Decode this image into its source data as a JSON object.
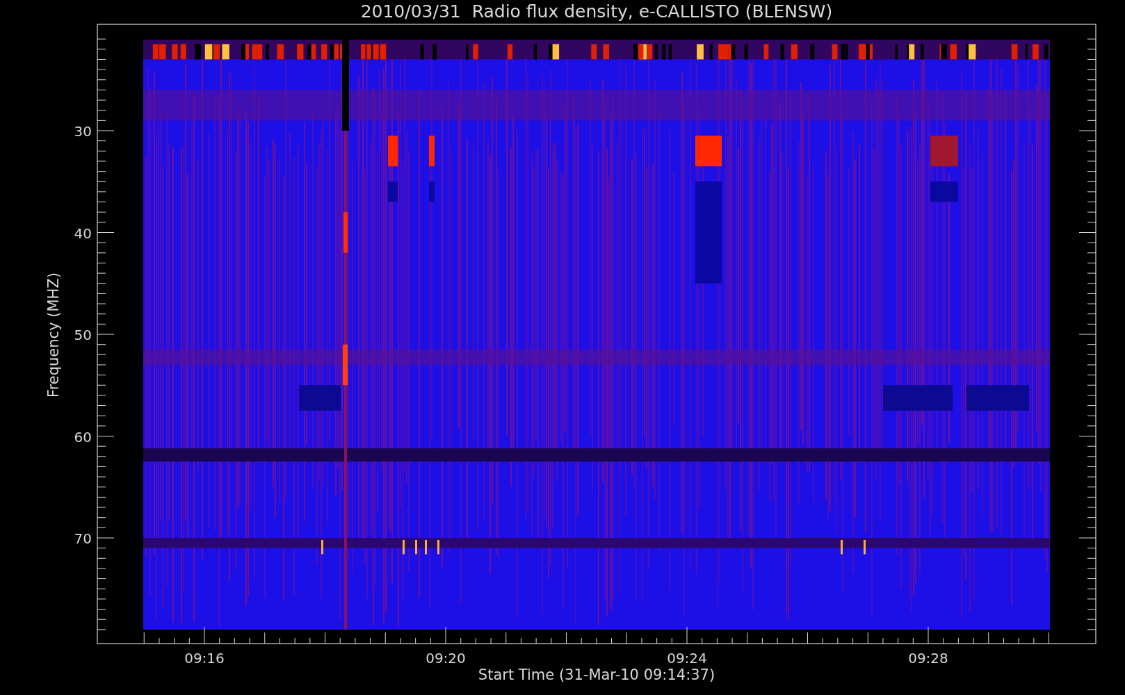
{
  "title": "2010/03/31  Radio flux density, e-CALLISTO (BLENSW)",
  "y_axis": {
    "label": "Frequency (MHZ)",
    "tick_labels": [
      "30",
      "40",
      "50",
      "60",
      "70"
    ]
  },
  "x_axis": {
    "label": "Start Time (31-Mar-10 09:14:37)",
    "tick_labels": [
      "09:16",
      "09:20",
      "09:24",
      "09:28"
    ]
  }
}
